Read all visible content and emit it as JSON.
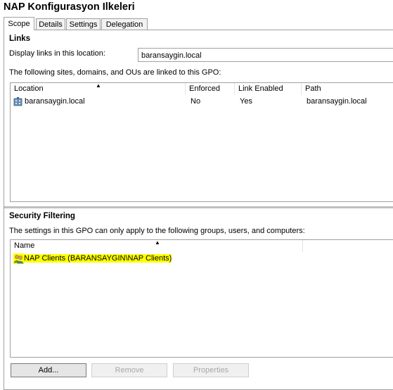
{
  "window": {
    "title": "NAP Konfigurasyon Ilkeleri"
  },
  "tabs": [
    {
      "label": "Scope",
      "active": true
    },
    {
      "label": "Details",
      "active": false
    },
    {
      "label": "Settings",
      "active": false
    },
    {
      "label": "Delegation",
      "active": false
    }
  ],
  "links": {
    "heading": "Links",
    "display_label": "Display links in this location:",
    "display_value": "baransaygin.local",
    "description": "The following sites, domains, and OUs are linked to this GPO:",
    "columns": [
      "Location",
      "Enforced",
      "Link Enabled",
      "Path"
    ],
    "rows": [
      {
        "location": "baransaygin.local",
        "enforced": "No",
        "link_enabled": "Yes",
        "path": "baransaygin.local"
      }
    ]
  },
  "security": {
    "heading": "Security Filtering",
    "description": "The settings in this GPO can only apply to the following groups, users, and computers:",
    "columns": [
      "Name"
    ],
    "rows": [
      {
        "name": "NAP Clients (BARANSAYGIN\\NAP Clients)"
      }
    ]
  },
  "buttons": {
    "add": "Add...",
    "remove": "Remove",
    "properties": "Properties"
  },
  "icons": {
    "domain": "domain-icon",
    "group": "group-icon"
  }
}
